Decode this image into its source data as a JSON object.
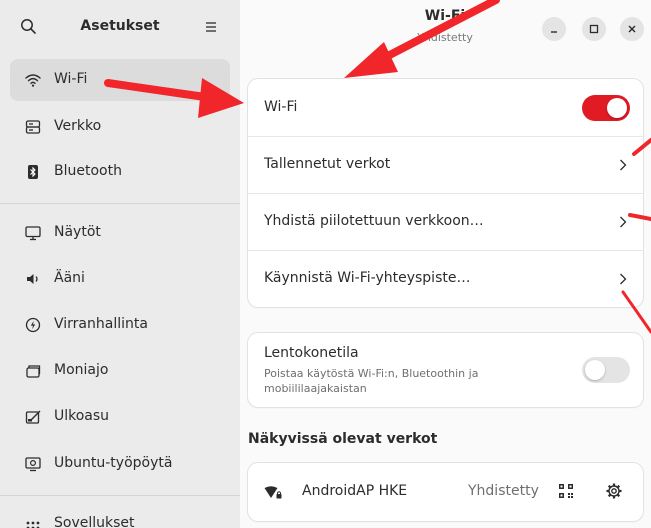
{
  "sidebar": {
    "title": "Asetukset",
    "items": [
      {
        "label": "Wi-Fi",
        "icon": "wifi-icon",
        "active": true
      },
      {
        "label": "Verkko",
        "icon": "network-icon"
      },
      {
        "label": "Bluetooth",
        "icon": "bluetooth-icon"
      },
      {
        "label": "Näytöt",
        "icon": "display-icon"
      },
      {
        "label": "Ääni",
        "icon": "speaker-icon"
      },
      {
        "label": "Virranhallinta",
        "icon": "power-icon"
      },
      {
        "label": "Moniajo",
        "icon": "multitasking-icon"
      },
      {
        "label": "Ulkoasu",
        "icon": "appearance-icon"
      },
      {
        "label": "Ubuntu-työpöytä",
        "icon": "ubuntu-desktop-icon"
      },
      {
        "label": "Sovellukset",
        "icon": "apps-icon"
      }
    ]
  },
  "header": {
    "title": "Wi-Fi",
    "subtitle": "Yhdistetty"
  },
  "wifi_card": {
    "wifi_label": "Wi-Fi",
    "wifi_enabled": true,
    "saved_networks": "Tallennetut verkot",
    "hidden_network": "Yhdistä piilotettuun verkkoon…",
    "hotspot": "Käynnistä Wi-Fi-yhteyspiste…"
  },
  "airplane": {
    "title": "Lentokonetila",
    "description": "Poistaa käytöstä Wi-Fi:n, Bluetoothin ja mobiililaajakaistan",
    "enabled": false
  },
  "visible_networks": {
    "heading": "Näkyvissä olevat verkot",
    "networks": [
      {
        "name": "AndroidAP HKE",
        "status": "Yhdistetty"
      }
    ]
  },
  "colors": {
    "accent": "#e01b24",
    "annotation_arrow": "#f0262b",
    "toggle_off": "#e4e4e4"
  }
}
